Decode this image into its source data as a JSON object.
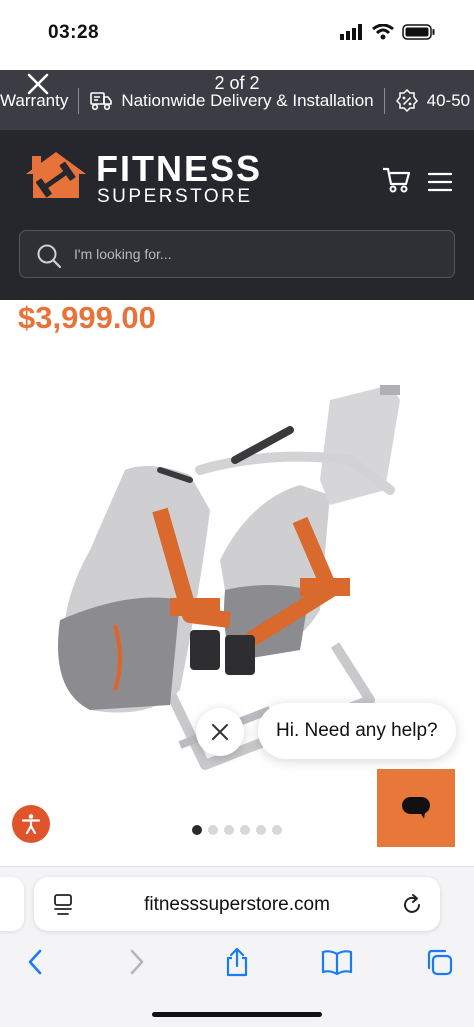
{
  "status_bar": {
    "time": "03:28"
  },
  "promo": {
    "counter": "2 of 2",
    "items": [
      {
        "icon": "shield-icon",
        "text": "Warranty"
      },
      {
        "icon": "delivery-truck-icon",
        "text": "Nationwide Delivery & Installation"
      },
      {
        "icon": "discount-badge-icon",
        "text": "40-50"
      }
    ]
  },
  "header": {
    "logo_line1": "FITNESS",
    "logo_line2": "SUPERSTORE",
    "search_placeholder": "I'm looking for..."
  },
  "product": {
    "price": "$3,999.00",
    "image": "elliptical-cross-trainer",
    "carousel_total": 6,
    "carousel_active": 1
  },
  "chat": {
    "greeting": "Hi. Need any help?"
  },
  "browser": {
    "url": "fitnesssuperstore.com"
  },
  "colors": {
    "accent": "#e8733a",
    "header_bg": "#26272d",
    "promo_bg": "#3c3d44",
    "link_blue": "#1a7cf5"
  }
}
